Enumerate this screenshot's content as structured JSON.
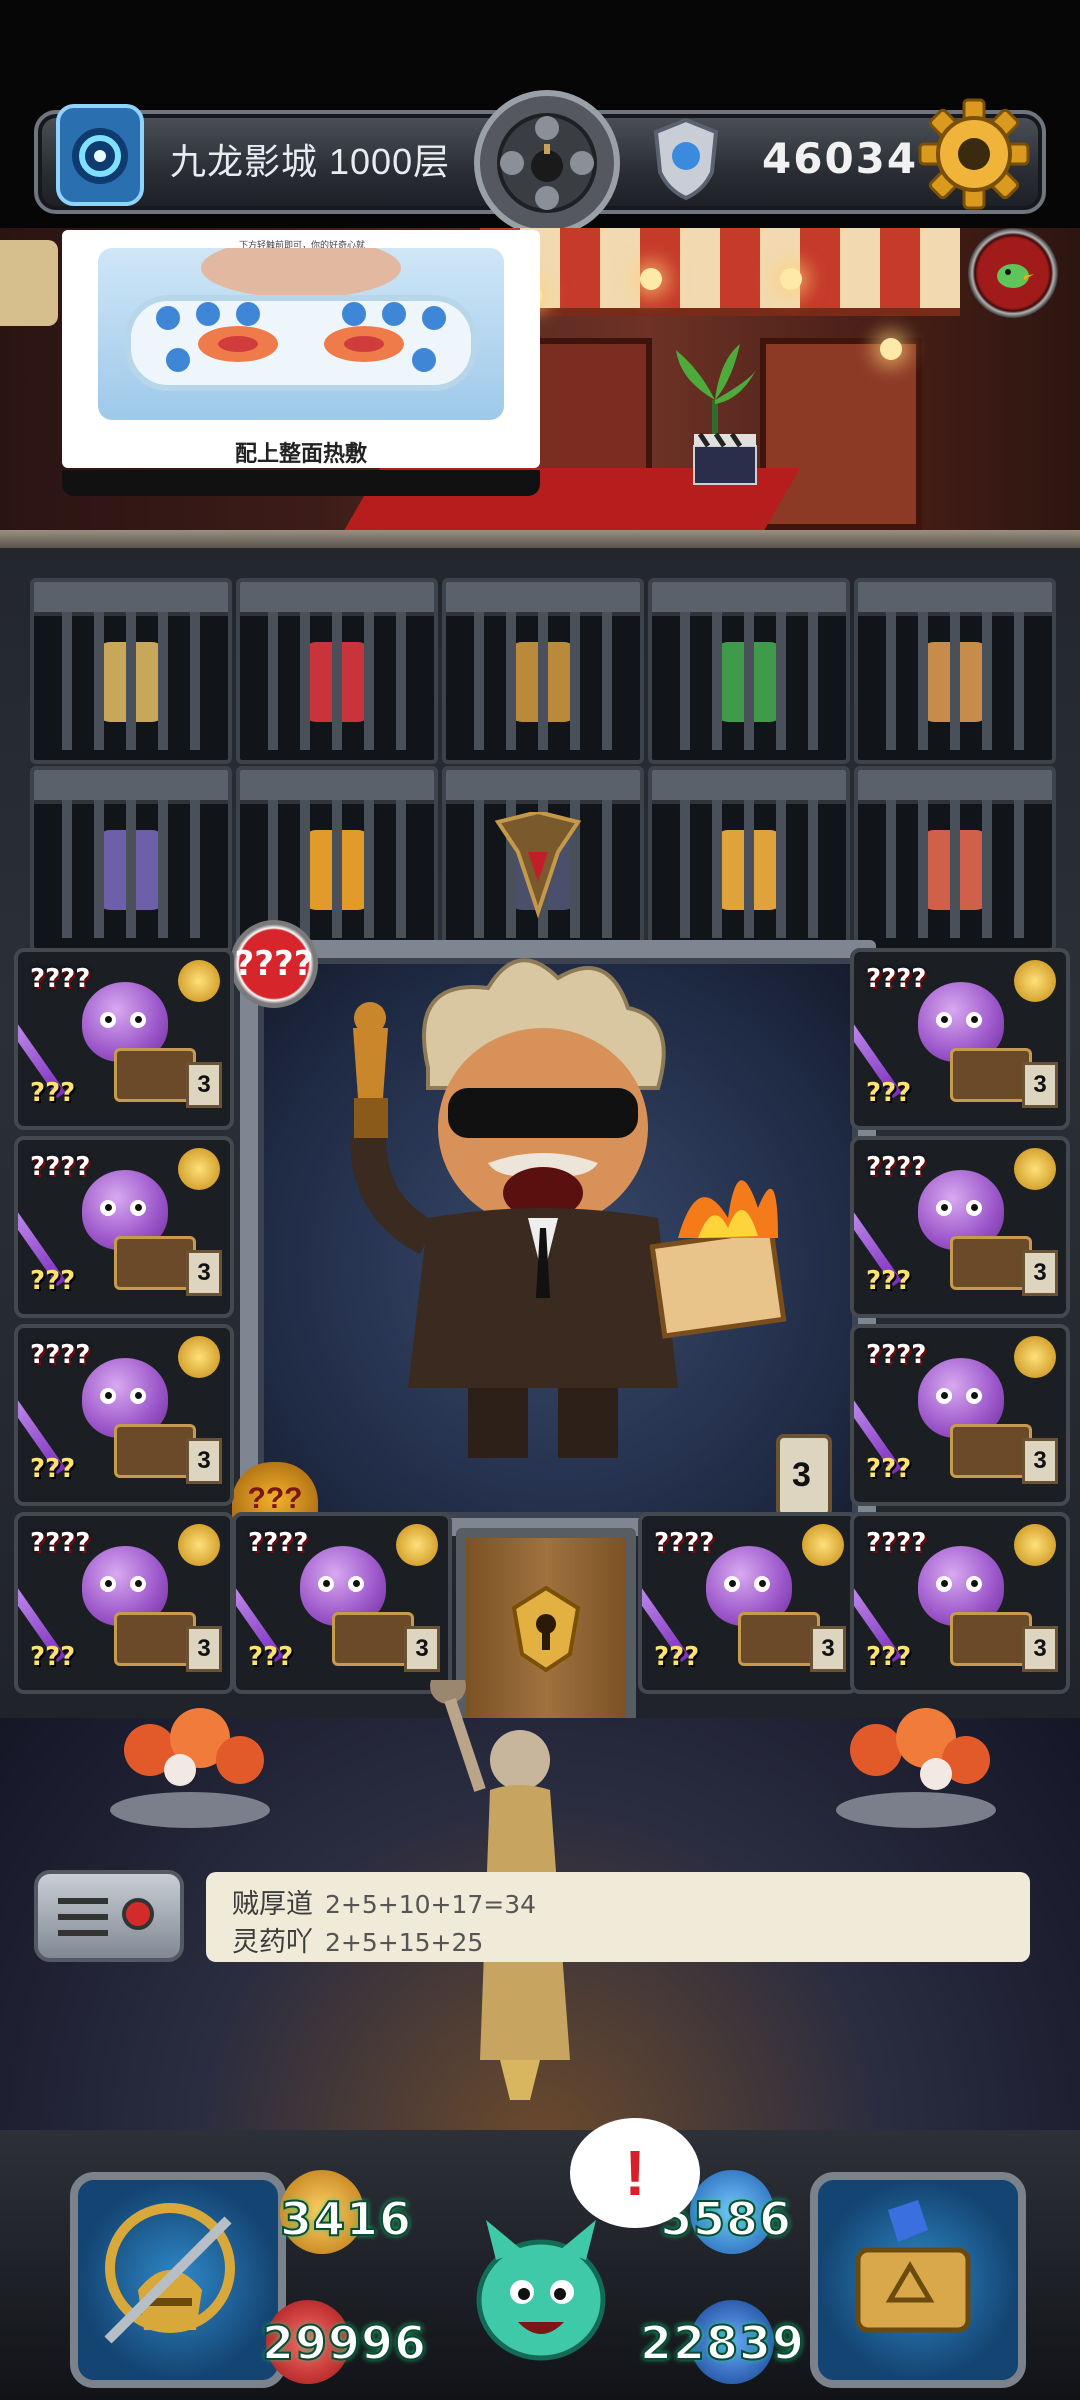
{
  "topbar": {
    "floor_label": "九龙影城 1000层",
    "coin_count": "46034"
  },
  "ad": {
    "caption_top": "下方轻触前即可，你的好奇心就",
    "title": "配上整面热敷"
  },
  "chamber": {
    "mystery_badge": "????",
    "floor_badge": "???",
    "hourglass_count": "3"
  },
  "enemies": [
    {
      "lvl": "????",
      "hp": "???",
      "count": "3"
    },
    {
      "lvl": "????",
      "hp": "???",
      "count": "3"
    },
    {
      "lvl": "????",
      "hp": "???",
      "count": "3"
    },
    {
      "lvl": "????",
      "hp": "???",
      "count": "3"
    },
    {
      "lvl": "????",
      "hp": "???",
      "count": "3"
    },
    {
      "lvl": "????",
      "hp": "???",
      "count": "3"
    },
    {
      "lvl": "????",
      "hp": "???",
      "count": "3"
    },
    {
      "lvl": "????",
      "hp": "???",
      "count": "3"
    },
    {
      "lvl": "????",
      "hp": "???",
      "count": "3"
    },
    {
      "lvl": "????",
      "hp": "???",
      "count": "3"
    },
    {
      "lvl": "????",
      "hp": "???",
      "count": "3"
    },
    {
      "lvl": "????",
      "hp": "???",
      "count": "3"
    }
  ],
  "chat": {
    "lines": [
      {
        "name": "贼厚道",
        "msg": "2+5+10+17=34"
      },
      {
        "name": "灵药吖",
        "msg": "2+5+15+25"
      }
    ]
  },
  "stats": {
    "attack": "3416",
    "defense": "5586",
    "hp": "29996",
    "mp": "22839"
  },
  "alert": "!",
  "colors": {
    "stat_glow": "#1ad07c",
    "badge_red": "#d7262b",
    "chat_bg": "#f0ead8"
  }
}
